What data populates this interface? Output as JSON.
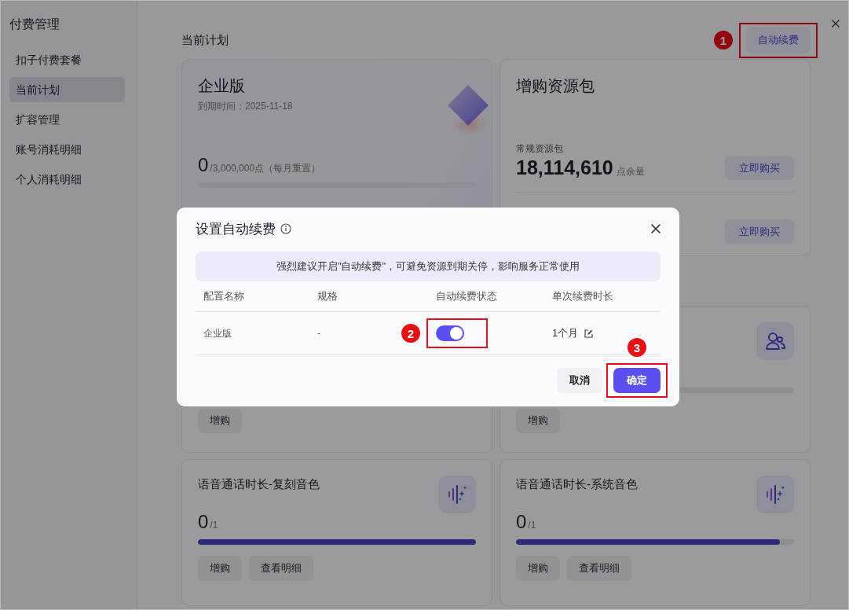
{
  "sidebar": {
    "title": "付费管理",
    "items": [
      {
        "label": "扣子付费套餐",
        "selected": false
      },
      {
        "label": "当前计划",
        "selected": true
      },
      {
        "label": "扩容管理",
        "selected": false
      },
      {
        "label": "账号消耗明细",
        "selected": false
      },
      {
        "label": "个人消耗明细",
        "selected": false
      }
    ]
  },
  "header": {
    "title": "当前计划",
    "auto_renew_button": {
      "label": "自动续费",
      "callout": {
        "number": "1"
      }
    }
  },
  "plan_card": {
    "title": "企业版",
    "expiry": "到期时间：2025-11-18",
    "used": "0",
    "quota": "/3,000,000点（每月重置）",
    "level": 0
  },
  "resource_card": {
    "title": "增购资源包",
    "packs": [
      {
        "label": "常规资源包",
        "amount": "18,114,610",
        "unit": "点余量",
        "button": "立即购买"
      },
      {
        "button": "立即购买"
      }
    ]
  },
  "mid_cards": [
    {
      "kind": "plain",
      "buttons": [
        "增购"
      ]
    },
    {
      "kind": "users",
      "level": 0,
      "buttons": [
        "增购"
      ]
    }
  ],
  "usage_cards": [
    {
      "title": "语音通话时长-复刻音色",
      "used": "0",
      "total": "/1",
      "level": 1,
      "buttons": [
        "增购",
        "查看明细"
      ]
    },
    {
      "title": "语音通话时长-系统音色",
      "used": "0",
      "total": "/1",
      "level": 0.95,
      "buttons": [
        "增购",
        "查看明细"
      ]
    }
  ],
  "dialog": {
    "title": "设置自动续费",
    "notice": "强烈建议开启\"自动续费\"，可避免资源到期关停，影响服务正常使用",
    "columns": [
      "配置名称",
      "规格",
      "自动续费状态",
      "单次续费时长"
    ],
    "rows": [
      {
        "name": "企业版",
        "spec": "-",
        "auto_renew": true,
        "duration": "1个月",
        "callout": {
          "number": "2"
        }
      }
    ],
    "buttons": [
      {
        "label": "取消",
        "kind": "secondary"
      },
      {
        "label": "确定",
        "kind": "primary",
        "callout": {
          "number": "3"
        }
      }
    ]
  }
}
